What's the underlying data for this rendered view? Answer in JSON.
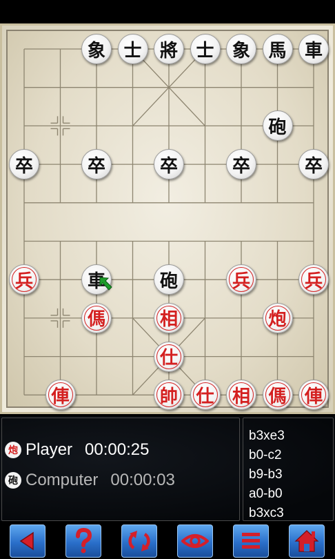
{
  "board": {
    "pieces": [
      {
        "char": "象",
        "side": "black",
        "col": 2,
        "row": 0
      },
      {
        "char": "士",
        "side": "black",
        "col": 3,
        "row": 0
      },
      {
        "char": "將",
        "side": "black",
        "col": 4,
        "row": 0
      },
      {
        "char": "士",
        "side": "black",
        "col": 5,
        "row": 0
      },
      {
        "char": "象",
        "side": "black",
        "col": 6,
        "row": 0
      },
      {
        "char": "馬",
        "side": "black",
        "col": 7,
        "row": 0
      },
      {
        "char": "車",
        "side": "black",
        "col": 8,
        "row": 0
      },
      {
        "char": "砲",
        "side": "black",
        "col": 7,
        "row": 2
      },
      {
        "char": "卒",
        "side": "black",
        "col": 0,
        "row": 3
      },
      {
        "char": "卒",
        "side": "black",
        "col": 2,
        "row": 3
      },
      {
        "char": "卒",
        "side": "black",
        "col": 4,
        "row": 3
      },
      {
        "char": "卒",
        "side": "black",
        "col": 6,
        "row": 3
      },
      {
        "char": "卒",
        "side": "black",
        "col": 8,
        "row": 3
      },
      {
        "char": "車",
        "side": "black",
        "col": 2,
        "row": 6
      },
      {
        "char": "砲",
        "side": "black",
        "col": 4,
        "row": 6
      },
      {
        "char": "兵",
        "side": "red",
        "col": 0,
        "row": 6
      },
      {
        "char": "兵",
        "side": "red",
        "col": 6,
        "row": 6
      },
      {
        "char": "兵",
        "side": "red",
        "col": 8,
        "row": 6
      },
      {
        "char": "傌",
        "side": "red",
        "col": 2,
        "row": 7
      },
      {
        "char": "相",
        "side": "red",
        "col": 4,
        "row": 7
      },
      {
        "char": "炮",
        "side": "red",
        "col": 7,
        "row": 7
      },
      {
        "char": "仕",
        "side": "red",
        "col": 4,
        "row": 8
      },
      {
        "char": "俥",
        "side": "red",
        "col": 1,
        "row": 9
      },
      {
        "char": "帥",
        "side": "red",
        "col": 4,
        "row": 9
      },
      {
        "char": "仕",
        "side": "red",
        "col": 5,
        "row": 9
      },
      {
        "char": "相",
        "side": "red",
        "col": 6,
        "row": 9
      },
      {
        "char": "傌",
        "side": "red",
        "col": 7,
        "row": 9
      },
      {
        "char": "俥",
        "side": "red",
        "col": 8,
        "row": 9
      }
    ],
    "markers": [
      {
        "col": 1,
        "row": 2
      },
      {
        "col": 1,
        "row": 7
      }
    ],
    "cursor": {
      "col": 2,
      "row": 6,
      "icon": "green-arrow-icon",
      "color": "#1e9e2a"
    }
  },
  "players": [
    {
      "badge": "炮",
      "badge_color": "#d42020",
      "name": "Player",
      "time": "00:00:25",
      "active": true
    },
    {
      "badge": "砲",
      "badge_color": "#111111",
      "name": "Computer",
      "time": "00:00:03",
      "active": false
    }
  ],
  "moves": [
    "b3xe3",
    "b0-c2",
    "b9-b3",
    "a0-b0",
    "b3xc3"
  ],
  "toolbar": [
    {
      "name": "back-button",
      "icon": "left-triangle-icon"
    },
    {
      "name": "hint-button",
      "icon": "question-mark-icon"
    },
    {
      "name": "flip-board-button",
      "icon": "rotate-arrows-icon"
    },
    {
      "name": "view-button",
      "icon": "eye-icon"
    },
    {
      "name": "menu-button",
      "icon": "menu-bars-icon"
    },
    {
      "name": "home-button",
      "icon": "house-icon"
    }
  ],
  "colors": {
    "red_piece": "#d42020",
    "black_piece": "#111111",
    "button_blue": "#2a6fca",
    "icon_red": "#d41f2a"
  }
}
